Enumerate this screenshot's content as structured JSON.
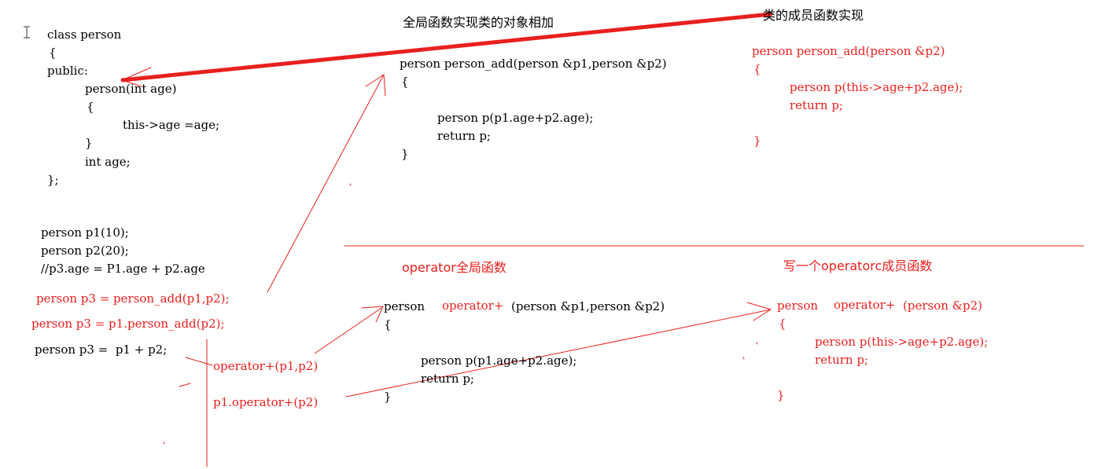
{
  "class_def": {
    "line1": "class person",
    "line2": "{",
    "line3": "public:",
    "line4": "person(int age)",
    "line5": "{",
    "line6": "this->age =age;",
    "line7": "}",
    "line8": "int age;",
    "line9": "};"
  },
  "usage": {
    "p1": "person p1(10);",
    "p2": "person p2(20);",
    "comment": "//p3.age = P1.age + p2.age",
    "call_global": "person p3 = person_add(p1,p2);",
    "call_member": "person p3 = p1.person_add(p2);",
    "call_operator": "person p3 =  p1 + p2;",
    "expand_global": "operator+(p1,p2)",
    "expand_member": "p1.operator+(p2)"
  },
  "global_add": {
    "title": "全局函数实现类的对象相加",
    "sig": "person person_add(person &p1,person &p2)",
    "open": "{",
    "body1": "person p(p1.age+p2.age);",
    "body2": "return p;",
    "close": "}"
  },
  "member_add": {
    "title": "类的成员函数实现",
    "sig": "person person_add(person &p2)",
    "open": "{",
    "body1": "person p(this->age+p2.age);",
    "body2": "return p;",
    "close": "}"
  },
  "global_op": {
    "title": "operator全局函数",
    "sig_ret": "person",
    "sig_name": "operator+",
    "sig_params": "(person &p1,person &p2)",
    "open": "{",
    "body1": "person p(p1.age+p2.age);",
    "body2": "return p;",
    "close": "}"
  },
  "member_op": {
    "title": "写一个operatorc成员函数",
    "sig_ret": "person",
    "sig_name": "operator+",
    "sig_params": "(person &p2)",
    "open": "{",
    "body1": "person p(this->age+p2.age);",
    "body2": "return p;",
    "close": "}"
  },
  "colors": {
    "ink": "#000000",
    "annotation": "#e8201e"
  },
  "icons": {
    "cursor": "text-cursor-icon"
  }
}
